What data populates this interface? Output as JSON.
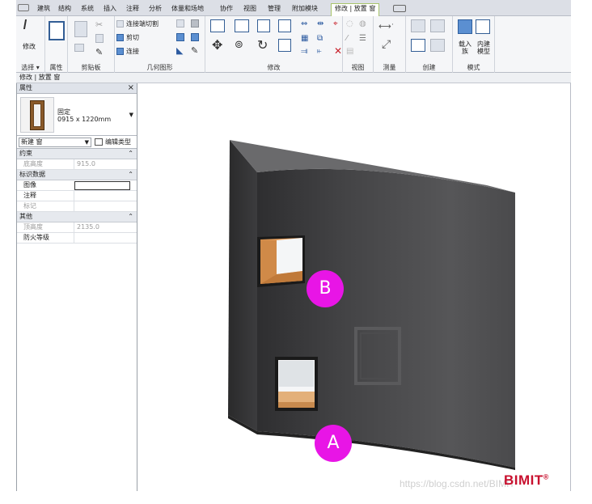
{
  "ribbon": {
    "tabs": [
      "建筑",
      "结构",
      "系统",
      "插入",
      "注释",
      "分析",
      "体量和场地",
      "协作",
      "视图",
      "管理",
      "附加模块",
      "修改 | 放置 窗"
    ],
    "active_tab": "修改 | 放置 窗",
    "panels": {
      "select": {
        "label": "选择 ▾",
        "modify": "修改"
      },
      "properties": {
        "label": "属性"
      },
      "clipboard": {
        "label": "剪贴板"
      },
      "geometry": {
        "label": "几何图形",
        "items": [
          "连接端切割",
          "剪切",
          "连接"
        ]
      },
      "modify": {
        "label": "修改"
      },
      "view": {
        "label": "视图"
      },
      "measure": {
        "label": "测量"
      },
      "create": {
        "label": "创建"
      },
      "mode": {
        "label": "模式",
        "load_family": "载入族",
        "inplace_model": "内建模型"
      }
    }
  },
  "context_bar": "修改 | 放置 窗",
  "properties": {
    "title": "属性",
    "type_name": "固定",
    "type_size": "0915 x 1220mm",
    "instance_selector": "新建 窗",
    "edit_type": "编辑类型",
    "groups": [
      {
        "name": "约束",
        "rows": [
          {
            "name": "底高度",
            "value": "915.0",
            "dim": true
          }
        ]
      },
      {
        "name": "标识数据",
        "rows": [
          {
            "name": "图像",
            "value": "",
            "dim": false,
            "box": true
          },
          {
            "name": "注释",
            "value": "",
            "dim": false
          },
          {
            "name": "标记",
            "value": "",
            "dim": true
          }
        ]
      },
      {
        "name": "其他",
        "rows": [
          {
            "name": "顶高度",
            "value": "2135.0",
            "dim": true
          },
          {
            "name": "防火等级",
            "value": "",
            "dim": false
          }
        ]
      }
    ]
  },
  "markers": {
    "a": "A",
    "b": "B"
  },
  "logo": {
    "text": "BIMIT",
    "mark": "®"
  },
  "watermark": "https://blog.csdn.net/BIMIT"
}
